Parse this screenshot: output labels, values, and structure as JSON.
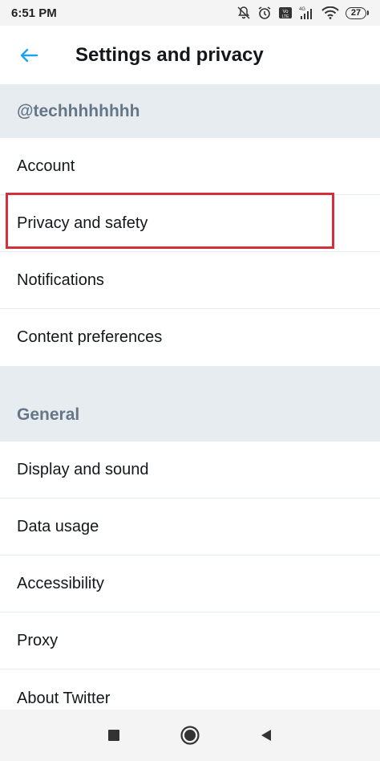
{
  "status_bar": {
    "time": "6:51 PM",
    "battery": "27",
    "icons": [
      "mute-icon",
      "alarm-icon",
      "volte-icon",
      "signal-icon",
      "wifi-icon",
      "battery-icon"
    ]
  },
  "header": {
    "back_icon": "back-arrow-icon",
    "title": "Settings and privacy"
  },
  "account_section": {
    "username": "@techhhhhhhh",
    "items": [
      {
        "label": "Account"
      },
      {
        "label": "Privacy and safety",
        "highlighted": true
      },
      {
        "label": "Notifications"
      },
      {
        "label": "Content preferences"
      }
    ]
  },
  "general_section": {
    "title": "General",
    "items": [
      {
        "label": "Display and sound"
      },
      {
        "label": "Data usage"
      },
      {
        "label": "Accessibility"
      },
      {
        "label": "Proxy"
      },
      {
        "label": "About Twitter"
      }
    ]
  },
  "nav_bar": {
    "buttons": [
      "recents-icon",
      "home-icon",
      "back-icon"
    ]
  },
  "colors": {
    "accent": "#1da1f2",
    "section_bg": "#e6ecf0",
    "section_text": "#657786",
    "highlight": "#d32f3c"
  }
}
